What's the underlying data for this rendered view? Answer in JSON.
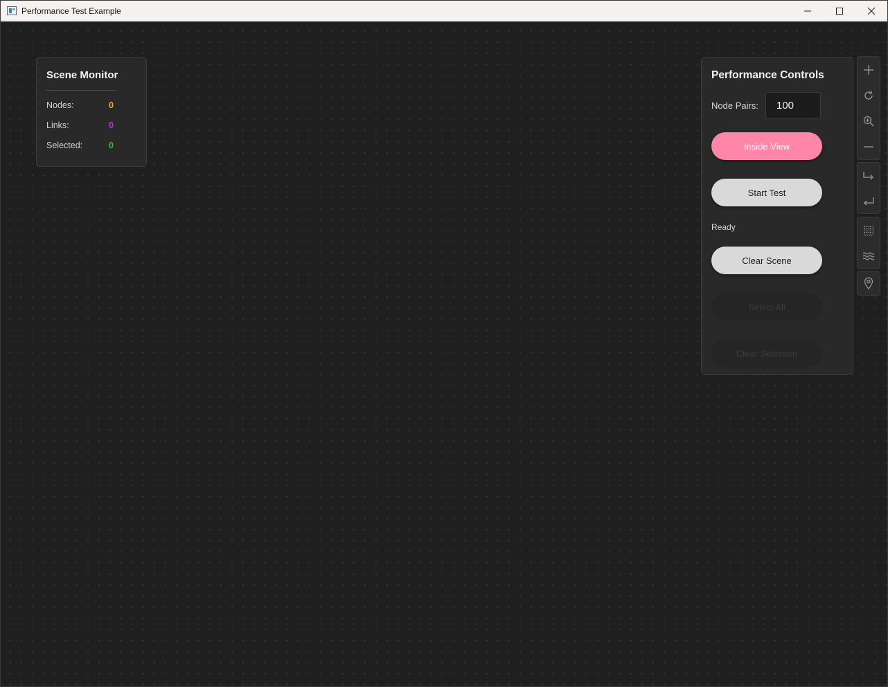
{
  "window": {
    "title": "Performance Test Example",
    "minimize_icon": "minimize-icon",
    "maximize_icon": "maximize-icon",
    "close_icon": "close-icon"
  },
  "scene_monitor": {
    "title": "Scene Monitor",
    "stats": [
      {
        "label": "Nodes:",
        "value": "0",
        "color": "#f5a623"
      },
      {
        "label": "Links:",
        "value": "0",
        "color": "#b33dc6"
      },
      {
        "label": "Selected:",
        "value": "0",
        "color": "#4caf50"
      }
    ]
  },
  "performance_controls": {
    "title": "Performance Controls",
    "node_pairs_label": "Node Pairs:",
    "node_pairs_value": "100",
    "inside_view_label": "Inside View",
    "start_test_label": "Start Test",
    "status_text": "Ready",
    "clear_scene_label": "Clear Scene",
    "select_all_label": "Select All",
    "clear_selection_label": "Clear Selection",
    "accent_color": "#ff86a8"
  },
  "toolbar": {
    "groups": [
      [
        "plus-icon",
        "rotate-icon",
        "zoom-in-icon",
        "minus-icon"
      ],
      [
        "redo-arrow-icon",
        "undo-return-icon"
      ],
      [
        "grid-icon",
        "waves-icon"
      ],
      [
        "location-pin-icon"
      ]
    ]
  }
}
